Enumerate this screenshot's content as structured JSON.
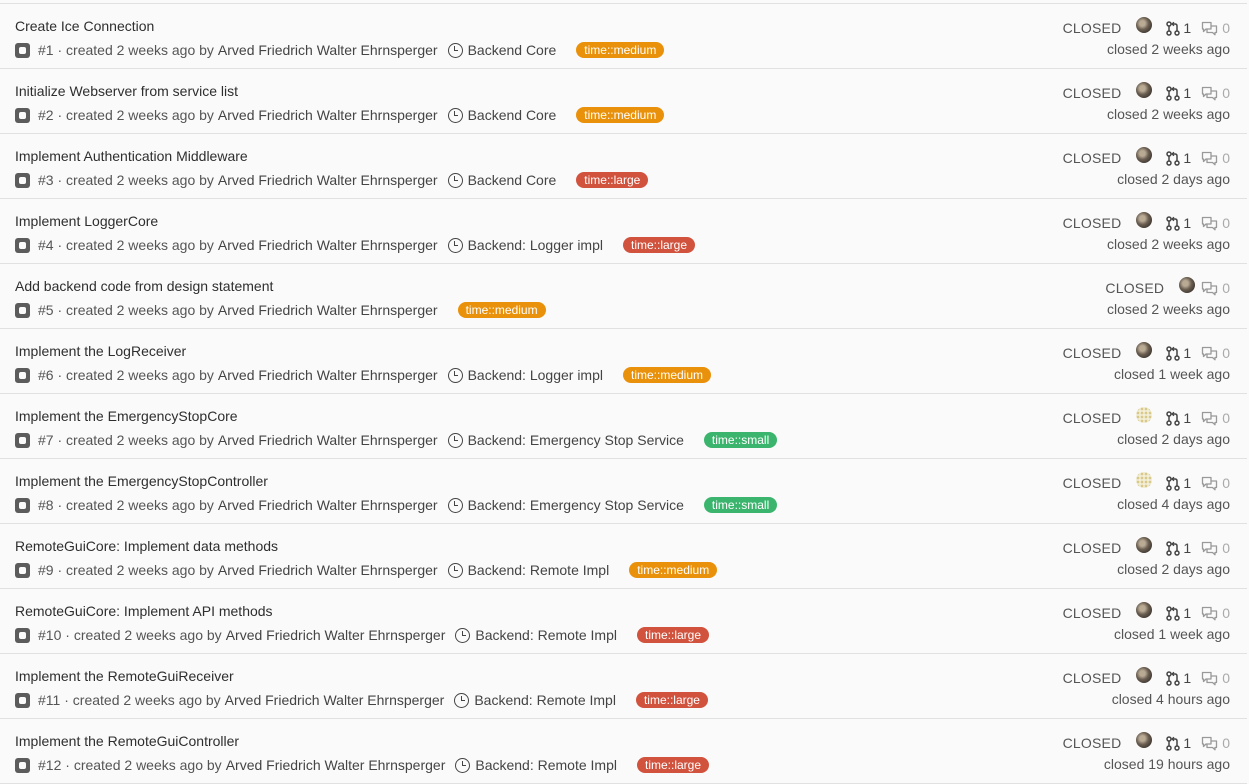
{
  "issues": [
    {
      "title": "Create Ice Connection",
      "ref": "#1",
      "created": "created 2 weeks ago by",
      "author": "Arved Friedrich Walter Ehrnsperger",
      "milestone": "Backend Core",
      "label": "time::medium",
      "label_color": "#e9910a",
      "state": "CLOSED",
      "avatar": "photo",
      "mr_count": "1",
      "comments": "0",
      "closed": "closed 2 weeks ago"
    },
    {
      "title": "Initialize Webserver from service list",
      "ref": "#2",
      "created": "created 2 weeks ago by",
      "author": "Arved Friedrich Walter Ehrnsperger",
      "milestone": "Backend Core",
      "label": "time::medium",
      "label_color": "#e9910a",
      "state": "CLOSED",
      "avatar": "photo",
      "mr_count": "1",
      "comments": "0",
      "closed": "closed 2 weeks ago"
    },
    {
      "title": "Implement Authentication Middleware",
      "ref": "#3",
      "created": "created 2 weeks ago by",
      "author": "Arved Friedrich Walter Ehrnsperger",
      "milestone": "Backend Core",
      "label": "time::large",
      "label_color": "#d1533e",
      "state": "CLOSED",
      "avatar": "photo",
      "mr_count": "1",
      "comments": "0",
      "closed": "closed 2 days ago"
    },
    {
      "title": "Implement LoggerCore",
      "ref": "#4",
      "created": "created 2 weeks ago by",
      "author": "Arved Friedrich Walter Ehrnsperger",
      "milestone": "Backend: Logger impl",
      "label": "time::large",
      "label_color": "#d1533e",
      "state": "CLOSED",
      "avatar": "photo",
      "mr_count": "1",
      "comments": "0",
      "closed": "closed 2 weeks ago"
    },
    {
      "title": "Add backend code from design statement",
      "ref": "#5",
      "created": "created 2 weeks ago by",
      "author": "Arved Friedrich Walter Ehrnsperger",
      "milestone": "",
      "label": "time::medium",
      "label_color": "#e9910a",
      "state": "CLOSED",
      "avatar": "photo",
      "mr_count": "",
      "comments": "0",
      "closed": "closed 2 weeks ago"
    },
    {
      "title": "Implement the LogReceiver",
      "ref": "#6",
      "created": "created 2 weeks ago by",
      "author": "Arved Friedrich Walter Ehrnsperger",
      "milestone": "Backend: Logger impl",
      "label": "time::medium",
      "label_color": "#e9910a",
      "state": "CLOSED",
      "avatar": "photo",
      "mr_count": "1",
      "comments": "0",
      "closed": "closed 1 week ago"
    },
    {
      "title": "Implement the EmergencyStopCore",
      "ref": "#7",
      "created": "created 2 weeks ago by",
      "author": "Arved Friedrich Walter Ehrnsperger",
      "milestone": "Backend: Emergency Stop Service",
      "label": "time::small",
      "label_color": "#3bb56d",
      "state": "CLOSED",
      "avatar": "pattern",
      "mr_count": "1",
      "comments": "0",
      "closed": "closed 2 days ago"
    },
    {
      "title": "Implement the EmergencyStopController",
      "ref": "#8",
      "created": "created 2 weeks ago by",
      "author": "Arved Friedrich Walter Ehrnsperger",
      "milestone": "Backend: Emergency Stop Service",
      "label": "time::small",
      "label_color": "#3bb56d",
      "state": "CLOSED",
      "avatar": "pattern",
      "mr_count": "1",
      "comments": "0",
      "closed": "closed 4 days ago"
    },
    {
      "title": "RemoteGuiCore: Implement data methods",
      "ref": "#9",
      "created": "created 2 weeks ago by",
      "author": "Arved Friedrich Walter Ehrnsperger",
      "milestone": "Backend: Remote Impl",
      "label": "time::medium",
      "label_color": "#e9910a",
      "state": "CLOSED",
      "avatar": "photo",
      "mr_count": "1",
      "comments": "0",
      "closed": "closed 2 days ago"
    },
    {
      "title": "RemoteGuiCore: Implement API methods",
      "ref": "#10",
      "created": "created 2 weeks ago by",
      "author": "Arved Friedrich Walter Ehrnsperger",
      "milestone": "Backend: Remote Impl",
      "label": "time::large",
      "label_color": "#d1533e",
      "state": "CLOSED",
      "avatar": "photo",
      "mr_count": "1",
      "comments": "0",
      "closed": "closed 1 week ago"
    },
    {
      "title": "Implement the RemoteGuiReceiver",
      "ref": "#11",
      "created": "created 2 weeks ago by",
      "author": "Arved Friedrich Walter Ehrnsperger",
      "milestone": "Backend: Remote Impl",
      "label": "time::large",
      "label_color": "#d1533e",
      "state": "CLOSED",
      "avatar": "photo",
      "mr_count": "1",
      "comments": "0",
      "closed": "closed 4 hours ago"
    },
    {
      "title": "Implement the RemoteGuiController",
      "ref": "#12",
      "created": "created 2 weeks ago by",
      "author": "Arved Friedrich Walter Ehrnsperger",
      "milestone": "Backend: Remote Impl",
      "label": "time::large",
      "label_color": "#d1533e",
      "state": "CLOSED",
      "avatar": "photo",
      "mr_count": "1",
      "comments": "0",
      "closed": "closed 19 hours ago"
    }
  ]
}
